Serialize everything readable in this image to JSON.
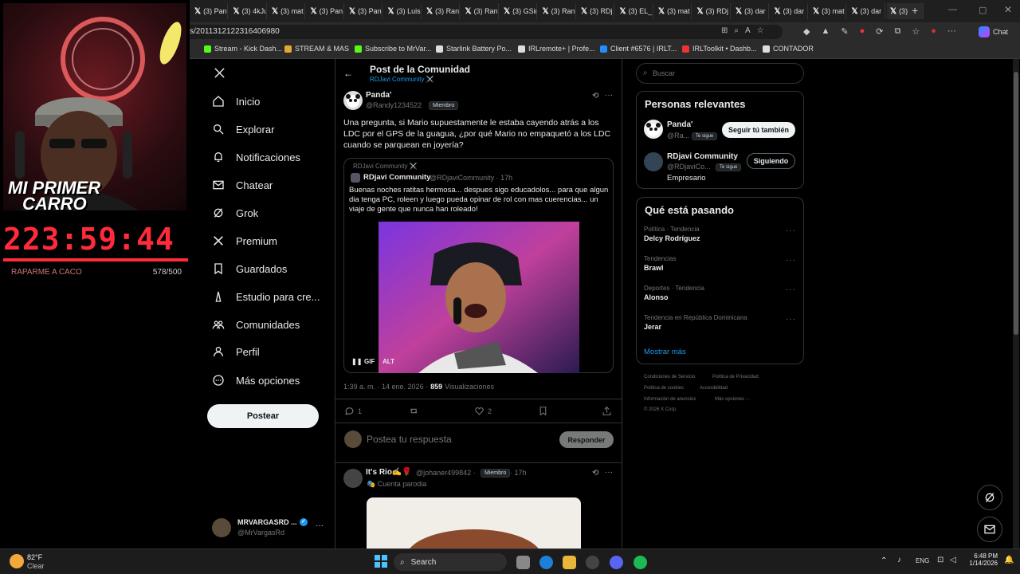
{
  "browser": {
    "tabs": [
      "(3) Pan",
      "(3) 4kJu",
      "(3) mat",
      "(3) Pan",
      "(3) Pan",
      "(3) Luis",
      "(3) Ran",
      "(3) Ran",
      "(3) GSin",
      "(3) Ran",
      "(3) RDj",
      "(3) EL_",
      "(3) mat",
      "(3) RDj",
      "(3) dar",
      "(3) dar",
      "(3) mat",
      "(3) dar",
      "(3)"
    ],
    "url": "s/2011312122316406980",
    "chat_label": "Chat",
    "bookmarks": [
      "Stream - Kick Dash...",
      "STREAM & MAS",
      "Subscribe to MrVar...",
      "Starlink Battery Po...",
      "IRLremote+ | Profe...",
      "Client #6576 | IRLT...",
      "IRLToolkit • Dashb...",
      "CONTADOR"
    ]
  },
  "overlay": {
    "cam_caption_line1": "MI PRIMER",
    "cam_caption_line2": "CARRO",
    "timer": "223:59:44",
    "goal_label": "RAPARME A CACO",
    "goal_count": "578/500",
    "progress": 1.0
  },
  "nav": {
    "items": [
      "Inicio",
      "Explorar",
      "Notificaciones",
      "Chatear",
      "Grok",
      "Premium",
      "Guardados",
      "Estudio para cre...",
      "Comunidades",
      "Perfil",
      "Más opciones"
    ],
    "post_button": "Postear",
    "account_name": "MRVARGASRD ...",
    "account_handle": "@MrVargasRd"
  },
  "header": {
    "title": "Post de la Comunidad",
    "subtitle": "RDJavi Community ⚔️"
  },
  "post": {
    "author": "Panda'",
    "handle": "@Randy1234522",
    "badge": "Miembro",
    "text": "Una pregunta, si Mario supuestamente le estaba cayendo atrás a los LDC por el GPS de la guagua, ¿por qué Mario no empaquetó a los LDC cuando se parquean en joyería?",
    "quote": {
      "community": "RDJavi Community ⚔️",
      "author": "RDjavi Community",
      "handle": "@RDjaviCommunity · 17h",
      "text": "Buenas noches ratitas hermosa... despues sigo educadolos... para que algun dia tenga PC, roleen y luego pueda opinar de rol con mas cuerencias... un viaje de gente que nunca han roleado!",
      "gif_label": "GIF",
      "alt_label": "ALT"
    },
    "time": "1:39 a. m. · 14 ene. 2026 ·",
    "views": "859",
    "views_label": "Visualizaciones",
    "replies": "1",
    "likes": "2"
  },
  "reply": {
    "placeholder": "Postea tu respuesta",
    "button": "Responder"
  },
  "second_post": {
    "author": "It's Rio✍️🌹",
    "handle": "@johaner499842 ·",
    "badge": "Miembro",
    "time": "· 17h",
    "sub": "🎭 Cuenta parodia"
  },
  "right": {
    "search_placeholder": "Buscar",
    "relevant_title": "Personas relevantes",
    "people": [
      {
        "name": "Panda'",
        "handle": "@Ra...",
        "follows_you": "Te sigue",
        "button": "Seguir tú también"
      },
      {
        "name": "RDjavi Community",
        "handle": "@RDjaviCo...",
        "follows_you": "Te sigue",
        "button": "Siguiendo",
        "role": "Empresario"
      }
    ],
    "trending_title": "Qué está pasando",
    "trends": [
      {
        "category": "Política · Tendencia",
        "name": "Delcy Rodríguez"
      },
      {
        "category": "Tendencias",
        "name": "Brawl"
      },
      {
        "category": "Deportes · Tendencia",
        "name": "Alonso"
      },
      {
        "category": "Tendencia en República Dominicana",
        "name": "Jerar"
      }
    ],
    "show_more": "Mostrar más",
    "footer": [
      "Condiciones de Servicio",
      "Política de Privacidad",
      "Política de cookies",
      "Accesibilidad",
      "Información de anuncios",
      "Más opciones ···",
      "© 2026 X Corp."
    ]
  },
  "taskbar": {
    "weather_temp": "82°F",
    "weather_desc": "Clear",
    "search_label": "Search",
    "lang": "ENG",
    "time": "6:48 PM",
    "date": "1/14/2026"
  },
  "colors": {
    "accent": "#1d9bf0",
    "timer": "#ff2a3a",
    "background": "#000000"
  }
}
